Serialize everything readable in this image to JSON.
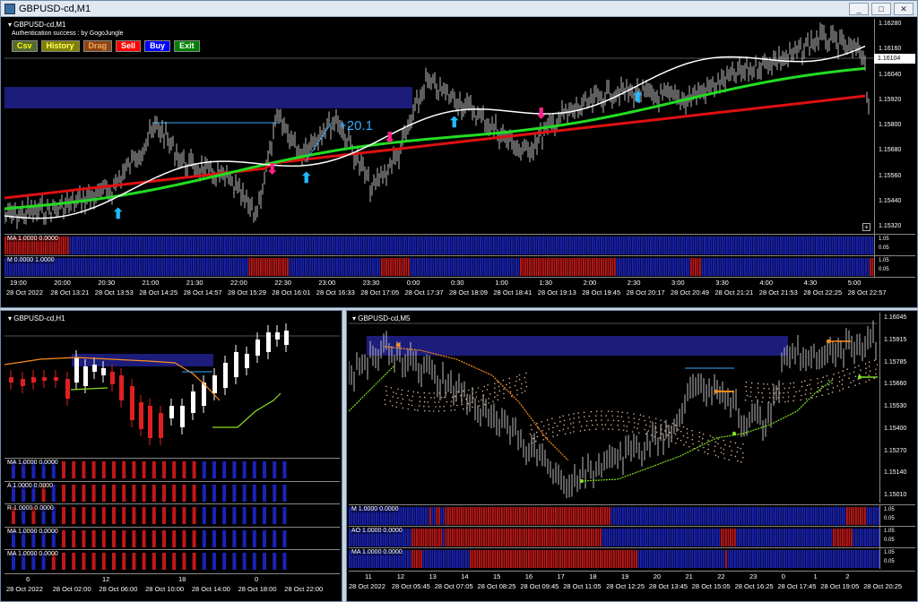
{
  "main": {
    "window_title": "GBPUSD-cd,M1",
    "chart_label": "GBPUSD-cd,M1",
    "auth_text": "Authentication success : by GogoJungle",
    "buttons": [
      {
        "label": "Csv",
        "bg": "#556b2f",
        "fg": "#ffff00"
      },
      {
        "label": "History",
        "bg": "#808000",
        "fg": "#ffff66"
      },
      {
        "label": "Drag",
        "bg": "#8b4513",
        "fg": "#f4a460"
      },
      {
        "label": "Sell",
        "bg": "#ff0000",
        "fg": "#ffffff"
      },
      {
        "label": "Buy",
        "bg": "#0000ff",
        "fg": "#ffffff"
      },
      {
        "label": "Exit",
        "bg": "#008000",
        "fg": "#ffffff"
      }
    ],
    "prices": [
      "1.16280",
      "1.16160",
      "1.16040",
      "1.15920",
      "1.15800",
      "1.15680",
      "1.15560",
      "1.15440",
      "1.15320"
    ],
    "current_price": "1.16104",
    "annotation": "+20.1",
    "sub1_label": "MA 1.0000 0.0000",
    "sub1_scale": [
      "1.05",
      "0.05"
    ],
    "sub2_label": "M 0.0000 1.0000",
    "sub2_scale": [
      "1.05",
      "0.05"
    ],
    "top_times": [
      "19:00",
      "20:00",
      "20:30",
      "21:00",
      "21:30",
      "22:00",
      "22:30",
      "23:00",
      "23:30",
      "0:00",
      "0:30",
      "1:00",
      "1:30",
      "2:00",
      "2:30",
      "3:00",
      "3:30",
      "4:00",
      "4:30",
      "5:00"
    ],
    "bottom_dates": [
      "28 Oct 2022",
      "28 Oct 13:21",
      "28 Oct 13:53",
      "28 Oct 14:25",
      "28 Oct 14:57",
      "28 Oct 15:29",
      "28 Oct 16:01",
      "28 Oct 16:33",
      "28 Oct 17:05",
      "28 Oct 17:37",
      "28 Oct 18:09",
      "28 Oct 18:41",
      "28 Oct 19:13",
      "28 Oct 19:45",
      "28 Oct 20:17",
      "28 Oct 20:49",
      "28 Oct 21:21",
      "28 Oct 21:53",
      "28 Oct 22:25",
      "28 Oct 22:57"
    ]
  },
  "h1": {
    "chart_label": "GBPUSD-cd,H1",
    "subs": [
      "MA 1.0000 0.0000",
      "A 1.0000 0.0000",
      "R 1.0000 0.0000",
      "MA 1.0000 0.0000",
      "MA 1.0000 0.0000"
    ],
    "top_times": [
      "6",
      "12",
      "18",
      "0"
    ],
    "bottom_dates": [
      "28 Oct 2022",
      "28 Oct 02:00",
      "28 Oct 06:00",
      "28 Oct 10:00",
      "28 Oct 14:00",
      "28 Oct 18:00",
      "28 Oct 22:00"
    ]
  },
  "m5": {
    "chart_label": "GBPUSD-cd,M5",
    "prices": [
      "1.16045",
      "1.15915",
      "1.15785",
      "1.15660",
      "1.15530",
      "1.15400",
      "1.15270",
      "1.15140",
      "1.15010"
    ],
    "subs": [
      "M 1.0000 0.0000",
      "AO 1.0000 0.0000",
      "MA 1.0000 0.0000"
    ],
    "sub_scale": [
      "1.05",
      "0.05"
    ],
    "top_times": [
      "11",
      "12",
      "13",
      "14",
      "15",
      "16",
      "17",
      "18",
      "19",
      "20",
      "21",
      "22",
      "23",
      "0",
      "1",
      "2"
    ],
    "bottom_dates": [
      "28 Oct 2022",
      "28 Oct 05:45",
      "28 Oct 07:05",
      "28 Oct 08:25",
      "28 Oct 09:45",
      "28 Oct 11:05",
      "28 Oct 12:25",
      "28 Oct 13:45",
      "28 Oct 15:05",
      "28 Oct 16:25",
      "28 Oct 17:45",
      "28 Oct 19:05",
      "28 Oct 20:25"
    ]
  },
  "colors": {
    "bull": "#1a23b8",
    "bear": "#c01818",
    "ma_green": "#22dd22",
    "ma_red": "#e01010",
    "ma_white": "#ffffff",
    "zone": "#1c1c7a"
  },
  "icons": [
    "window-icon",
    "minimize-icon",
    "maximize-icon",
    "close-icon",
    "dropdown-triangle-icon",
    "buy-arrow-icon",
    "sell-arrow-icon",
    "zoom-plus-icon"
  ]
}
